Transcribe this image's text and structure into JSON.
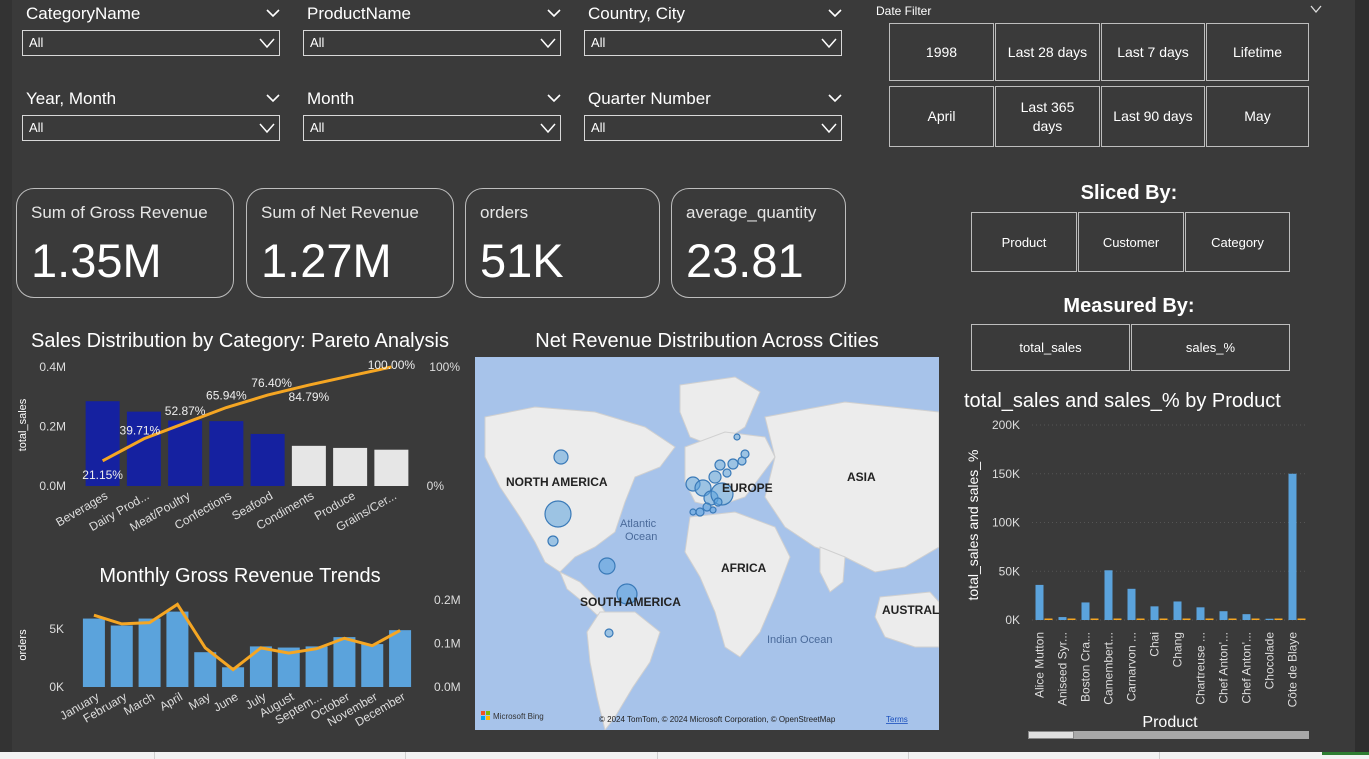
{
  "slicers": [
    {
      "title": "CategoryName",
      "value": "All"
    },
    {
      "title": "ProductName",
      "value": "All"
    },
    {
      "title": "Country, City",
      "value": "All"
    },
    {
      "title": "Year, Month",
      "value": "All"
    },
    {
      "title": "Month",
      "value": "All"
    },
    {
      "title": "Quarter Number",
      "value": "All"
    }
  ],
  "date_filter": {
    "label": "Date Filter",
    "tiles": [
      "1998",
      "Last 28 days",
      "Last 7 days",
      "Lifetime",
      "April",
      "Last 365 days",
      "Last 90 days",
      "May"
    ]
  },
  "kpis": [
    {
      "label": "Sum of Gross Revenue",
      "value": "1.35M"
    },
    {
      "label": "Sum of Net Revenue",
      "value": "1.27M"
    },
    {
      "label": "orders",
      "value": "51K"
    },
    {
      "label": "average_quantity",
      "value": "23.81"
    }
  ],
  "sliced_by": {
    "title": "Sliced By:",
    "options": [
      "Product",
      "Customer",
      "Category"
    ]
  },
  "measured_by": {
    "title": "Measured By:",
    "options": [
      "total_sales",
      "sales_%"
    ]
  },
  "map": {
    "title": "Net Revenue Distribution Across Cities",
    "labels": [
      "NORTH AMERICA",
      "EUROPE",
      "ASIA",
      "Atlantic Ocean",
      "AFRICA",
      "SOUTH AMERICA",
      "AUSTRALIA",
      "Indian Ocean"
    ],
    "attribution_bing": "Microsoft Bing",
    "attribution": "© 2024 TomTom, © 2024 Microsoft Corporation, © OpenStreetMap",
    "terms": "Terms"
  },
  "chart_data": [
    {
      "type": "bar",
      "title": "Sales Distribution by Category: Pareto Analysis",
      "ylabel": "total_sales",
      "categories": [
        "Beverages",
        "Dairy Prod...",
        "Meat/Poultry",
        "Confections",
        "Seafood",
        "Condiments",
        "Produce",
        "Grains/Cer..."
      ],
      "series": [
        {
          "name": "total_sales",
          "values": [
            285000,
            250000,
            220000,
            218000,
            175000,
            135000,
            128000,
            122000
          ]
        }
      ],
      "line": {
        "values": [
          21.15,
          39.71,
          52.87,
          65.94,
          76.4,
          84.79,
          92.5,
          100.0
        ],
        "labels": [
          "21.15%",
          "39.71%",
          "52.87%",
          "65.94%",
          "76.40%",
          "84.79%",
          "",
          "100.00%"
        ]
      },
      "highlight_colors": [
        "#1521a0",
        "#1521a0",
        "#1521a0",
        "#1521a0",
        "#1521a0",
        "#e6e6e6",
        "#e6e6e6",
        "#e6e6e6"
      ],
      "line_color": "#f5a623",
      "yticks_left": [
        "0.0M",
        "0.2M",
        "0.4M"
      ],
      "yticks_right": [
        "0%",
        "100%"
      ],
      "ylim": [
        0,
        400000
      ]
    },
    {
      "type": "bar",
      "title": "Monthly Gross Revenue Trends",
      "ylabel": "orders",
      "categories": [
        "January",
        "February",
        "March",
        "April",
        "May",
        "June",
        "July",
        "August",
        "Septem...",
        "October",
        "November",
        "December"
      ],
      "series": [
        {
          "name": "orders",
          "values": [
            5900,
            5300,
            5900,
            6500,
            3000,
            1700,
            3500,
            3400,
            3500,
            4300,
            3700,
            4900
          ]
        },
        {
          "name": "gross_revenue",
          "values": [
            0.165,
            0.145,
            0.148,
            0.19,
            0.09,
            0.04,
            0.09,
            0.078,
            0.088,
            0.112,
            0.095,
            0.13
          ]
        }
      ],
      "bar_color": "#5ba3dc",
      "line_color": "#f5a623",
      "yticks_left": [
        "0K",
        "5K"
      ],
      "yticks_right": [
        "0.0M",
        "0.1M",
        "0.2M"
      ],
      "ylim_left": [
        0,
        7500
      ],
      "ylim_right": [
        0,
        0.2
      ]
    },
    {
      "type": "bar",
      "title": "total_sales and sales_% by Product",
      "xlabel": "Product",
      "ylabel": "total_sales and sales_%",
      "categories": [
        "Alice Mutton",
        "Aniseed Syr...",
        "Boston Cra...",
        "Camembert...",
        "Carnarvon ...",
        "Chai",
        "Chang",
        "Chartreuse ...",
        "Chef Anton'...",
        "Chef Anton'...",
        "Chocolade",
        "Côte de Blaye"
      ],
      "series": [
        {
          "name": "total_sales",
          "values": [
            36000,
            3000,
            18000,
            51000,
            32000,
            14000,
            19000,
            13000,
            9000,
            6000,
            1300,
            150000
          ]
        },
        {
          "name": "sales_%",
          "values": [
            0,
            0,
            0,
            0,
            0,
            0,
            0,
            0,
            0,
            0,
            0,
            0
          ]
        }
      ],
      "bar_color": "#5ba3dc",
      "second_color": "#f5a623",
      "yticks": [
        "0K",
        "50K",
        "100K",
        "150K",
        "200K"
      ],
      "ylim": [
        0,
        200000
      ]
    }
  ]
}
